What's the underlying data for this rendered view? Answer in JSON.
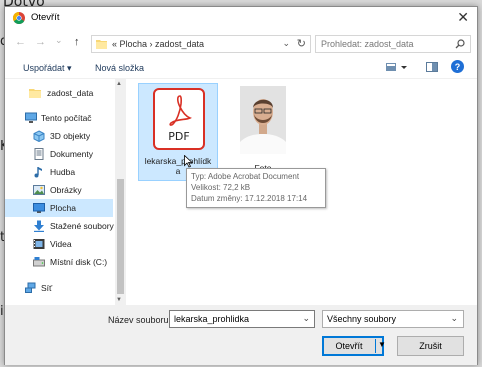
{
  "background": {
    "top_text": "Dotvo",
    "left_letters": [
      "d",
      "K",
      "t",
      "i"
    ]
  },
  "window": {
    "title": "Otevřít",
    "close_symbol": "✕"
  },
  "nav": {
    "back": "←",
    "forward": "→",
    "recent": "⌄",
    "up": "↑",
    "breadcrumb": "«  Plocha  ›  zadost_data",
    "search_placeholder": "Prohledat: zadost_data"
  },
  "toolbar": {
    "organize": "Uspořádat ▾",
    "new_folder": "Nová složka"
  },
  "sidebar": {
    "items": [
      {
        "label": "zadost_data",
        "icon": "folder-icon"
      },
      {
        "label": "Tento počítač",
        "icon": "computer-icon"
      },
      {
        "label": "3D objekty",
        "icon": "cube-icon"
      },
      {
        "label": "Dokumenty",
        "icon": "documents-icon"
      },
      {
        "label": "Hudba",
        "icon": "music-icon"
      },
      {
        "label": "Obrázky",
        "icon": "pictures-icon"
      },
      {
        "label": "Plocha",
        "icon": "desktop-icon"
      },
      {
        "label": "Stažené soubory",
        "icon": "download-icon"
      },
      {
        "label": "Videa",
        "icon": "video-icon"
      },
      {
        "label": "Místní disk (C:)",
        "icon": "disk-icon"
      },
      {
        "label": "Síť",
        "icon": "network-icon"
      }
    ],
    "selected": "Plocha"
  },
  "files": [
    {
      "name_line1": "lekarska_prohlídk",
      "name_line2": "a",
      "icon": "pdf-icon",
      "icon_text": "PDF"
    },
    {
      "name": "Foto",
      "icon": "photo-thumbnail"
    }
  ],
  "tooltip": {
    "type": "Typ: Adobe Acrobat Document",
    "size": "Velikost: 72,2 kB",
    "date": "Datum změny: 17.12.2018 17:14"
  },
  "bottom": {
    "filename_label": "Název souboru:",
    "filename_value": "lekarska_prohlidka",
    "filetype_value": "Všechny soubory",
    "open_button": "Otevřít",
    "cancel_button": "Zrušit"
  },
  "colors": {
    "selection": "#cce8ff",
    "accent": "#0078d7",
    "pdf_red": "#d93025"
  }
}
